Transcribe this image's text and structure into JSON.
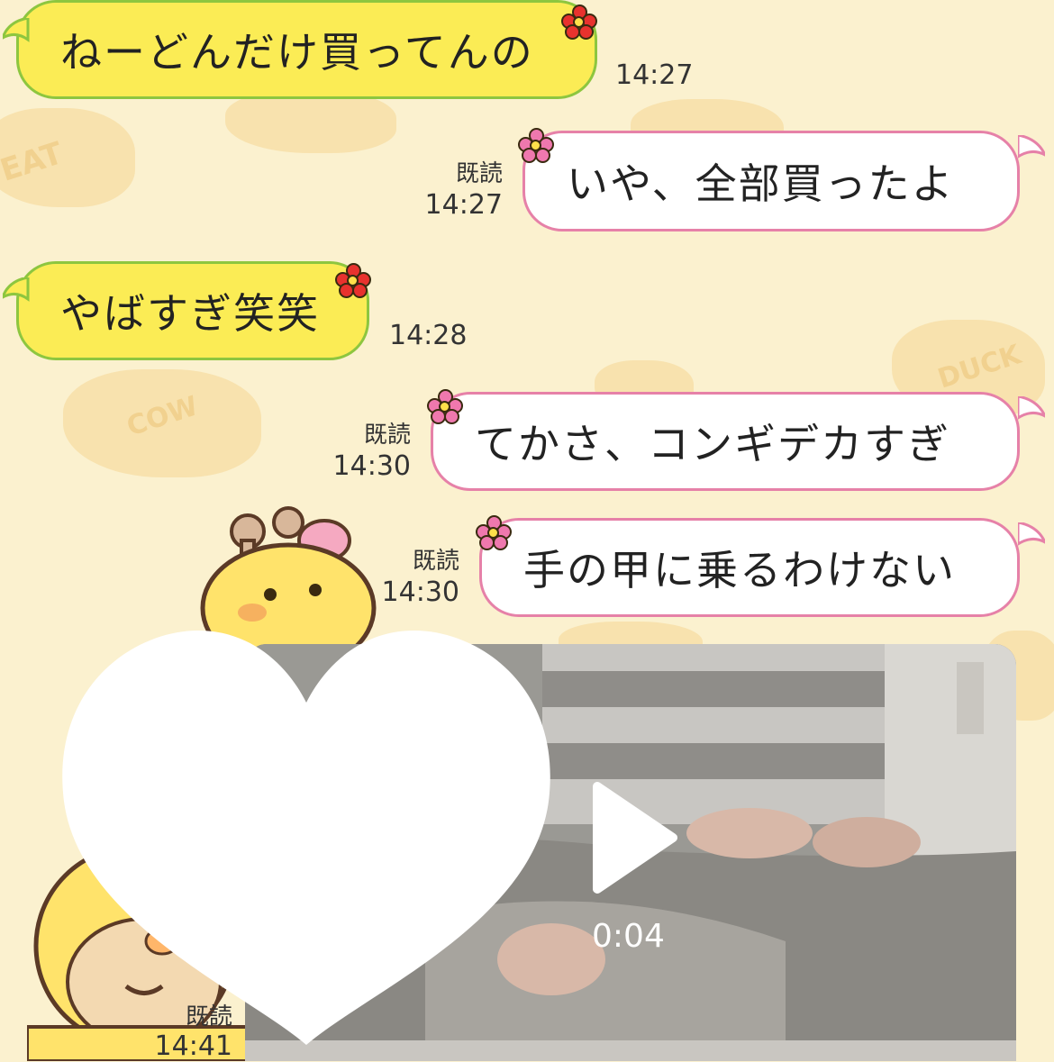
{
  "messages": [
    {
      "dir": "in",
      "text": "ねーどんだけ買ってんの",
      "time": "14:27"
    },
    {
      "dir": "out",
      "text": "いや、全部買ったよ",
      "read": "既読",
      "time": "14:27"
    },
    {
      "dir": "in",
      "text": "やばすぎ笑笑",
      "time": "14:28"
    },
    {
      "dir": "out",
      "text": "てかさ、コンギデカすぎ",
      "read": "既読",
      "time": "14:30"
    },
    {
      "dir": "out",
      "text": "手の甲に乗るわけない",
      "read": "既読",
      "time": "14:30"
    }
  ],
  "video_message": {
    "duration": "0:04",
    "read": "既読",
    "time": "14:41"
  },
  "background_cookie_labels": [
    "EAT",
    "COW",
    "DUCK"
  ],
  "colors": {
    "background": "#fbf1cf",
    "incoming_bubble": "#fbec55",
    "incoming_border": "#8dc63f",
    "outgoing_bubble": "#ffffff",
    "outgoing_border": "#e681a8",
    "flower_red": "#e8322e",
    "flower_pink": "#ef78ae"
  },
  "icons": {
    "bubble_decoration": "flower-icon",
    "video_control": "play-icon"
  }
}
